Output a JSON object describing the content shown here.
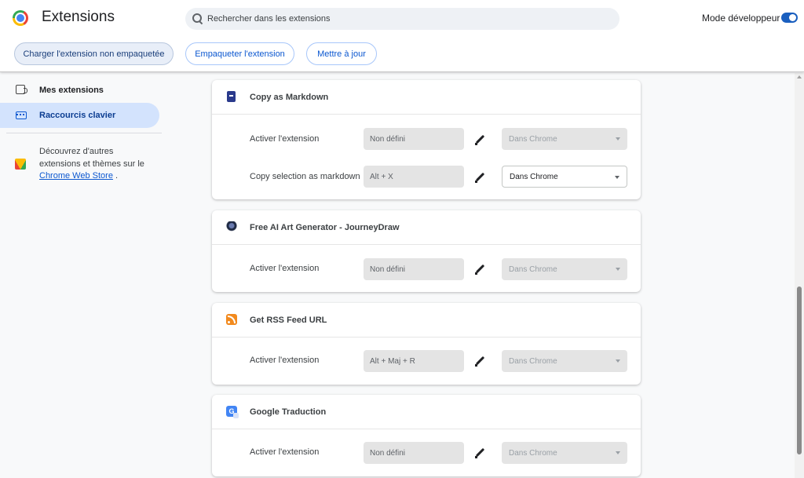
{
  "header": {
    "title": "Extensions",
    "search_placeholder": "Rechercher dans les extensions",
    "dev_mode_label": "Mode développeur",
    "dev_mode_on": true,
    "buttons": {
      "load_unpacked": "Charger l'extension non empaquetée",
      "pack": "Empaqueter l'extension",
      "update": "Mettre à jour"
    }
  },
  "sidebar": {
    "items": [
      {
        "label": "Mes extensions",
        "icon": "puzzle-icon",
        "active": false
      },
      {
        "label": "Raccourcis clavier",
        "icon": "keyboard-icon",
        "active": true
      }
    ],
    "store_text_before": "Découvrez d'autres extensions et thèmes sur le ",
    "store_link": "Chrome Web Store",
    "store_text_after": " ."
  },
  "cards": [
    {
      "name": "Copy as Markdown",
      "icon": "copy-as-markdown-icon",
      "rows": [
        {
          "label": "Activer l'extension",
          "shortcut": "Non défini",
          "scope": "Dans Chrome",
          "scope_enabled": false
        },
        {
          "label": "Copy selection as markdown",
          "shortcut": "Alt + X",
          "scope": "Dans Chrome",
          "scope_enabled": true
        }
      ]
    },
    {
      "name": "Free AI Art Generator - JourneyDraw",
      "icon": "journeydraw-icon",
      "rows": [
        {
          "label": "Activer l'extension",
          "shortcut": "Non défini",
          "scope": "Dans Chrome",
          "scope_enabled": false
        }
      ]
    },
    {
      "name": "Get RSS Feed URL",
      "icon": "rss-icon",
      "rows": [
        {
          "label": "Activer l'extension",
          "shortcut": "Alt + Maj + R",
          "scope": "Dans Chrome",
          "scope_enabled": false
        }
      ]
    },
    {
      "name": "Google Traduction",
      "icon": "google-translate-icon",
      "rows": [
        {
          "label": "Activer l'extension",
          "shortcut": "Non défini",
          "scope": "Dans Chrome",
          "scope_enabled": false
        }
      ]
    }
  ]
}
